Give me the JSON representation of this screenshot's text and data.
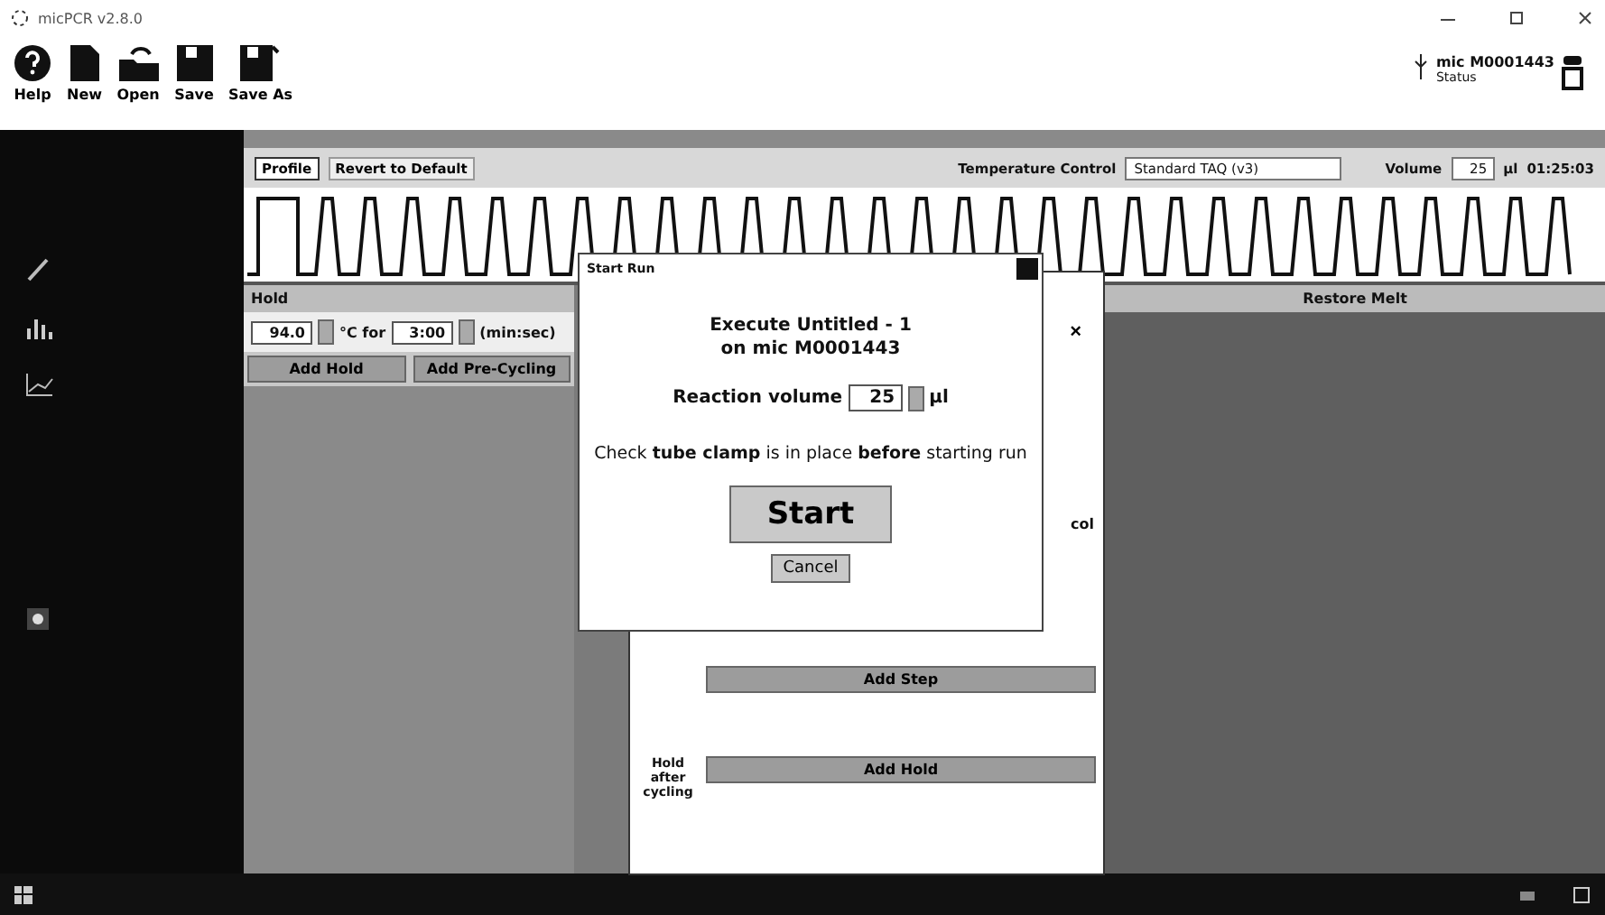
{
  "window": {
    "title": "micPCR v2.8.0"
  },
  "toolbar": [
    {
      "label": "Help",
      "kind": "help"
    },
    {
      "label": "New",
      "kind": "new"
    },
    {
      "label": "Open",
      "kind": "open"
    },
    {
      "label": "Save",
      "kind": "save"
    },
    {
      "label": "Save As",
      "kind": "saveas"
    }
  ],
  "device": {
    "name": "mic M0001443",
    "status": "Status"
  },
  "profile_bar": {
    "tabs": [
      {
        "label": "Profile",
        "selected": true
      },
      {
        "label": "Revert to Default",
        "selected": false
      }
    ],
    "temperature_label": "Temperature Control",
    "temperature_value": "Standard TAQ (v3)",
    "volume_label": "Volume",
    "volume_value": "25",
    "volume_unit": "µl",
    "time": "01:25:03"
  },
  "hold_panel": {
    "title": "Hold",
    "temperature": "94.0",
    "for_label": "°C for",
    "duration": "3:00",
    "unit": "(min:sec)",
    "buttons": [
      "Add Hold",
      "Add Pre-Cycling"
    ]
  },
  "melt_panel": {
    "title": "Restore Melt"
  },
  "profile_panel": {
    "close": "×",
    "partial_label": "col",
    "buttons": [
      "Add Step"
    ],
    "hold_after_label": "Hold after cycling",
    "hold_after_button": "Add Hold"
  },
  "dialog": {
    "title": "Start Run",
    "line_1": "Execute Untitled - 1",
    "line_2": "on mic M0001443",
    "volume_label": "Reaction volume",
    "volume_value": "25",
    "volume_unit": "µl",
    "message": "Check **tube clamp** is in place **before** starting run",
    "start": "Start",
    "cancel": "Cancel"
  }
}
